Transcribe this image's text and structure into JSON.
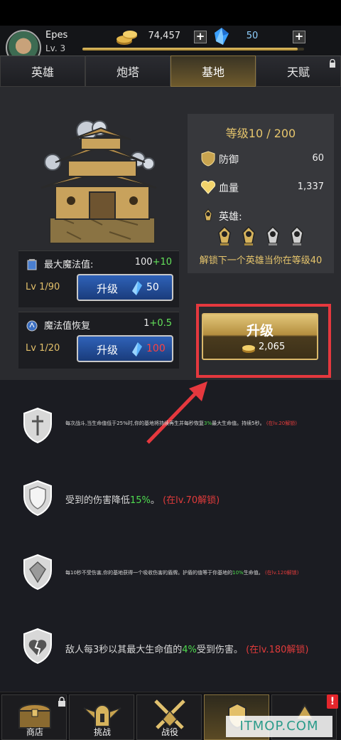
{
  "player": {
    "name": "Epes",
    "level": "Lv. 3",
    "xp_progress": 0.97
  },
  "currency": {
    "gold": "74,457",
    "gems": "50",
    "gold_icon": "coin-stack-icon",
    "gem_icon": "blue-crystal-icon"
  },
  "tabs": [
    {
      "label": "英雄",
      "active": false
    },
    {
      "label": "炮塔",
      "active": false
    },
    {
      "label": "基地",
      "active": true
    },
    {
      "label": "天赋",
      "active": false,
      "locked": true
    }
  ],
  "base": {
    "max_mana": {
      "label": "最大魔法值:",
      "value": "100",
      "increase": "+10",
      "level": "Lv 1/90",
      "button": "升级",
      "cost": "50"
    },
    "mana_regen": {
      "label": "魔法值恢复",
      "value": "1",
      "increase": "+0.5",
      "level": "Lv 1/20",
      "button": "升级",
      "cost": "100"
    },
    "info": {
      "level_title": "等级10 / 200",
      "defense_label": "防御",
      "defense_value": "60",
      "hp_label": "血量",
      "hp_value": "1,337",
      "heroes_label": "英雄:",
      "unlock_text": "解锁下一个英雄当你在等级40"
    },
    "upgrade": {
      "label": "升级",
      "cost": "2,065"
    }
  },
  "skills": [
    {
      "pre": "每次战斗,当生命值低于25%时,你的基地将持续再生并每秒恢复",
      "highlight": "3%",
      "post": "最大生命值。持续5秒。",
      "lock": "(在lv.20解锁)"
    },
    {
      "pre": "受到的伤害降低",
      "highlight": "15%",
      "post": "。",
      "lock": "(在lv.70解锁)"
    },
    {
      "pre": "每10秒不受伤害,你的基地获得一个吸收伤害的盾牌。护盾的值等于你基地的",
      "highlight": "10%",
      "post": "生命值。",
      "lock": "(在lv.120解锁)"
    },
    {
      "pre": "敌人每3秒以其最大生命值的",
      "highlight": "4%",
      "post": "受到伤害。",
      "lock": "(在lv.180解锁)"
    }
  ],
  "nav": [
    {
      "label": "商店",
      "locked": true
    },
    {
      "label": "挑战"
    },
    {
      "label": "战役"
    },
    {
      "label": "",
      "active": true
    },
    {
      "label": "",
      "badge": "!"
    }
  ],
  "watermark": "ITMOP.COM",
  "colors": {
    "gold": "#e6c56c",
    "highlight_green": "#4fdc4f",
    "lock_red": "#e03b3b",
    "frame_red": "#e5383e"
  }
}
